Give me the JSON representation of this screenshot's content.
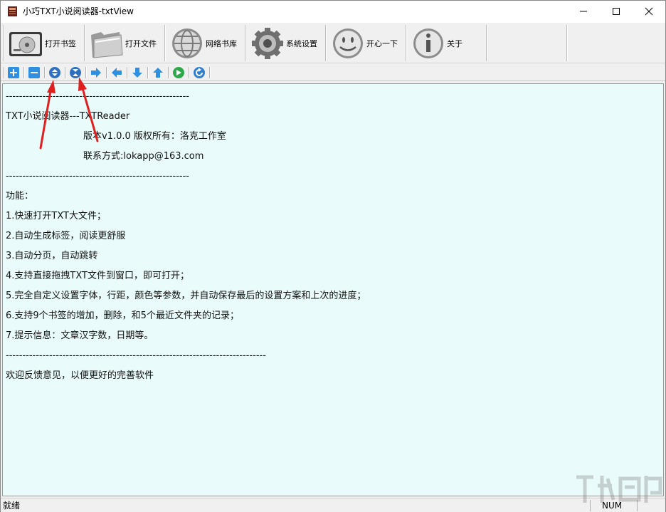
{
  "window": {
    "title": "小巧TXT小说阅读器-txtView"
  },
  "toolbar": {
    "buttons": [
      {
        "label": "打开书签",
        "icon": "bookmark-drive-icon"
      },
      {
        "label": "打开文件",
        "icon": "folder-icon"
      },
      {
        "label": "网络书库",
        "icon": "globe-icon"
      },
      {
        "label": "系统设置",
        "icon": "gear-icon"
      },
      {
        "label": "开心一下",
        "icon": "smiley-icon"
      },
      {
        "label": "关于",
        "icon": "info-icon"
      }
    ]
  },
  "small_toolbar": {
    "buttons": [
      "add-icon",
      "remove-icon",
      "page-up-circle-icon",
      "page-down-circle-icon",
      "arrow-right-icon",
      "arrow-left-icon",
      "arrow-down-icon",
      "arrow-up-icon",
      "play-icon",
      "refresh-icon"
    ]
  },
  "content": {
    "divider_short": "-------------------------------------------------------",
    "header": "TXT小说阅读器---TXTReader",
    "version": "版本v1.0.0 版权所有：洛克工作室",
    "contact": "联系方式:lokapp@163.com",
    "features_heading": "功能：",
    "features": [
      "1.快速打开TXT大文件；",
      "2.自动生成标签，阅读更舒服",
      "3.自动分页，自动跳转",
      "4.支持直接拖拽TXT文件到窗口，即可打开；",
      "5.完全自定义设置字体，行距，颜色等参数，并自动保存最后的设置方案和上次的进度；",
      "6.支持9个书签的增加，删除，和5个最近文件夹的记录；",
      "7.提示信息：文章汉字数，日期等。"
    ],
    "divider_long": "------------------------------------------------------------------------------",
    "feedback": "欢迎反馈意见，以便更好的完善软件"
  },
  "status": {
    "left": "就绪",
    "num": "NUM"
  },
  "colors": {
    "content_bg": "#eafbfb",
    "annotation_arrow": "#e02020",
    "small_icon_blue": "#2f8fe0"
  }
}
